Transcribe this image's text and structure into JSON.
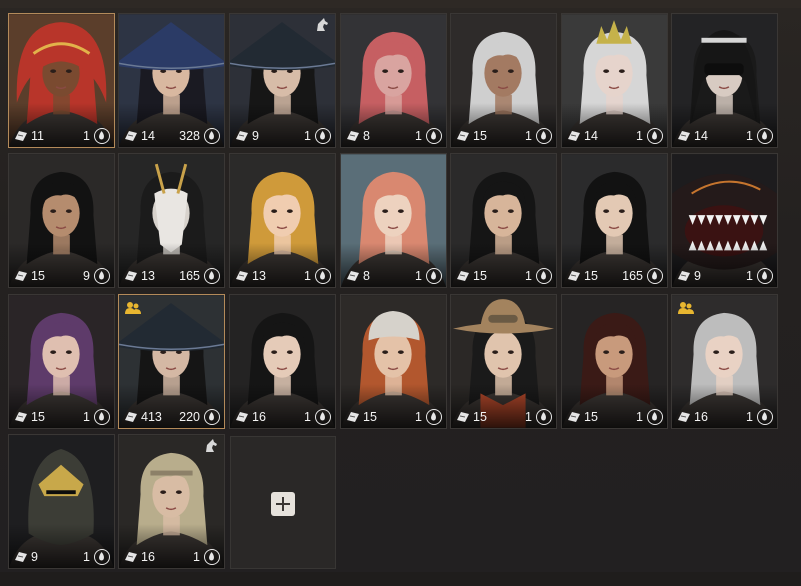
{
  "title": "",
  "add_button": {
    "label": "+"
  },
  "characters": [
    {
      "level": "11",
      "energy": "1",
      "horse": false,
      "group": false,
      "selected": true,
      "bg": "#5b3e2b",
      "skin": "#7a4a30",
      "hair": "#b8352a",
      "hat": "hood-red"
    },
    {
      "level": "14",
      "energy": "328",
      "horse": false,
      "group": false,
      "selected": false,
      "bg": "#2d3444",
      "skin": "#d9b8a0",
      "hair": "#1a1a22",
      "hat": "straw-blue"
    },
    {
      "level": "9",
      "energy": "1",
      "horse": true,
      "group": false,
      "selected": false,
      "bg": "#2d3038",
      "skin": "#d7bca8",
      "hair": "#161616",
      "hat": "straw-dark"
    },
    {
      "level": "8",
      "energy": "1",
      "horse": false,
      "group": false,
      "selected": false,
      "bg": "#333336",
      "skin": "#d9a4a0",
      "hair": "#c65f62",
      "hat": "none"
    },
    {
      "level": "15",
      "energy": "1",
      "horse": false,
      "group": false,
      "selected": false,
      "bg": "#2e2b2a",
      "skin": "#a37a62",
      "hair": "#cfcfcf",
      "hat": "none"
    },
    {
      "level": "14",
      "energy": "1",
      "horse": false,
      "group": false,
      "selected": false,
      "bg": "#3a3a3a",
      "skin": "#e6d4cc",
      "hair": "#d6d6d6",
      "hat": "crown"
    },
    {
      "level": "14",
      "energy": "1",
      "horse": false,
      "group": false,
      "selected": false,
      "bg": "#232325",
      "skin": "#d8cbc2",
      "hair": "#1a1a1a",
      "hat": "veil"
    },
    {
      "level": "15",
      "energy": "9",
      "horse": false,
      "group": false,
      "selected": false,
      "bg": "#2b2928",
      "skin": "#b58c6e",
      "hair": "#121212",
      "hat": "none"
    },
    {
      "level": "13",
      "energy": "165",
      "horse": false,
      "group": false,
      "selected": false,
      "bg": "#262626",
      "skin": "#d7d2cc",
      "hair": "#1b1b1b",
      "hat": "mask"
    },
    {
      "level": "13",
      "energy": "1",
      "horse": false,
      "group": false,
      "selected": false,
      "bg": "#2b2a29",
      "skin": "#f0cdb0",
      "hair": "#cf9a3a",
      "hat": "none"
    },
    {
      "level": "8",
      "energy": "1",
      "horse": false,
      "group": false,
      "selected": false,
      "bg": "#5a6e78",
      "skin": "#edd2bf",
      "hair": "#d98870",
      "hat": "none"
    },
    {
      "level": "15",
      "energy": "1",
      "horse": false,
      "group": false,
      "selected": false,
      "bg": "#2b2a2a",
      "skin": "#d7b59a",
      "hair": "#151515",
      "hat": "none"
    },
    {
      "level": "15",
      "energy": "165",
      "horse": false,
      "group": false,
      "selected": false,
      "bg": "#2b2b2c",
      "skin": "#e3c9b4",
      "hair": "#121212",
      "hat": "none"
    },
    {
      "level": "9",
      "energy": "1",
      "horse": false,
      "group": false,
      "selected": false,
      "bg": "#1d1c1e",
      "skin": "#2a2222",
      "hair": "#3a4a5a",
      "hat": "maw"
    },
    {
      "level": "15",
      "energy": "1",
      "horse": false,
      "group": false,
      "selected": false,
      "bg": "#2a2527",
      "skin": "#dfbfb0",
      "hair": "#5e3b6a",
      "hat": "none"
    },
    {
      "level": "413",
      "energy": "220",
      "horse": false,
      "group": true,
      "selected": true,
      "bg": "#2d3134",
      "skin": "#d4b8a4",
      "hair": "#151515",
      "hat": "straw-dark"
    },
    {
      "level": "16",
      "energy": "1",
      "horse": false,
      "group": false,
      "selected": false,
      "bg": "#242323",
      "skin": "#e5cbb8",
      "hair": "#151515",
      "hat": "none"
    },
    {
      "level": "15",
      "energy": "1",
      "horse": false,
      "group": false,
      "selected": false,
      "bg": "#2d2a28",
      "skin": "#e4c2a8",
      "hair": "#b2572e",
      "hat": "cap-white"
    },
    {
      "level": "15",
      "energy": "1",
      "horse": false,
      "group": false,
      "selected": false,
      "bg": "#2b2826",
      "skin": "#e0c4ad",
      "hair": "#1a1a1a",
      "hat": "cowboy"
    },
    {
      "level": "15",
      "energy": "1",
      "horse": false,
      "group": false,
      "selected": false,
      "bg": "#262424",
      "skin": "#c89a7c",
      "hair": "#3a1a16",
      "hat": "none"
    },
    {
      "level": "16",
      "energy": "1",
      "horse": false,
      "group": true,
      "selected": false,
      "bg": "#2e2c2c",
      "skin": "#e9d2c4",
      "hair": "#bdbdbd",
      "hat": "none"
    },
    {
      "level": "9",
      "energy": "1",
      "horse": false,
      "group": false,
      "selected": false,
      "bg": "#1e1e20",
      "skin": "#3a3a36",
      "hair": "#5d5a3d",
      "hat": "helmet"
    },
    {
      "level": "16",
      "energy": "1",
      "horse": true,
      "group": false,
      "selected": false,
      "bg": "#2a2826",
      "skin": "#d8bca4",
      "hair": "#b8ad8c",
      "hat": "headband"
    }
  ]
}
